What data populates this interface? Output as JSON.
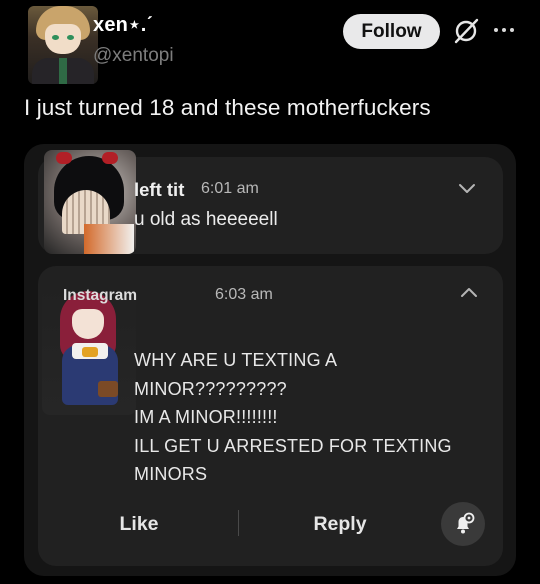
{
  "header": {
    "display_name": "xen⋆.ˊ",
    "handle": "@xentopi",
    "follow_label": "Follow",
    "icons": [
      "avatar",
      "grok-icon",
      "more-icon"
    ]
  },
  "tweet": {
    "text": "I just turned 18 and these motherfuckers"
  },
  "notifications": [
    {
      "sender": "left tit",
      "time": "6:01 am",
      "message": "u old as heeeeell",
      "chevron": "chevron-down-icon"
    },
    {
      "sender": "Instagram",
      "time": "6:03 am",
      "message_lines": [
        "WHY ARE U TEXTING A",
        "MINOR?????????",
        "IM A MINOR!!!!!!!!",
        "ILL GET U ARRESTED FOR TEXTING",
        "MINORS"
      ],
      "chevron": "chevron-up-icon",
      "actions": {
        "like_label": "Like",
        "reply_label": "Reply",
        "bell_icon": "bell-settings-icon"
      }
    }
  ],
  "colors": {
    "background": "#000000",
    "group_bg": "#151515",
    "card_bg": "#212121",
    "follow_bg": "#e9e9ea",
    "secondary_text": "#7d7d7d"
  }
}
